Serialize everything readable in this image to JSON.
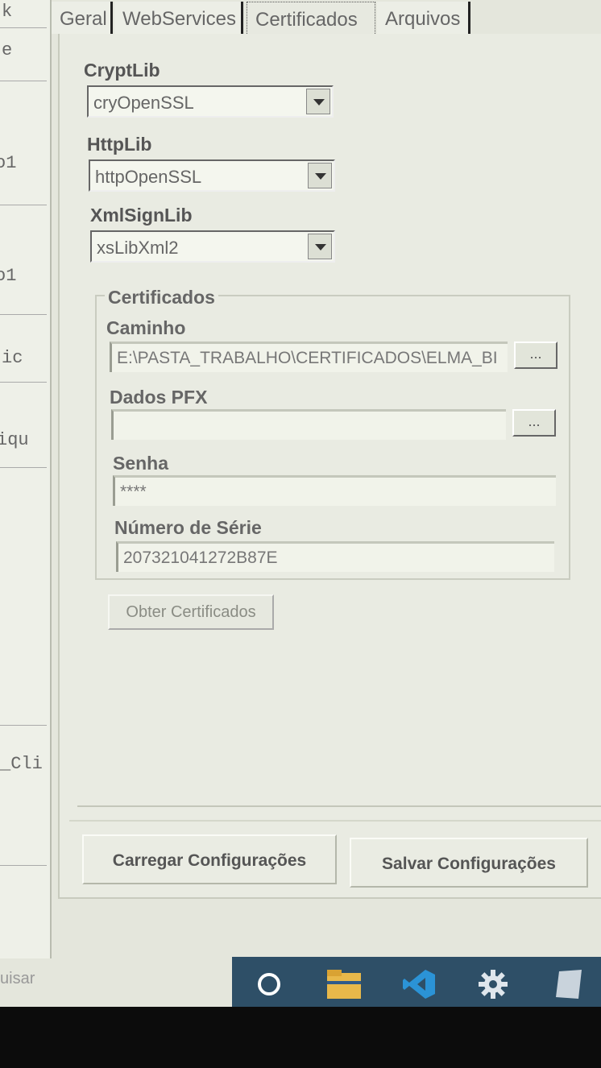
{
  "left_strip": {
    "fragments": [
      "k",
      "e",
      "o1",
      "o1",
      "ic",
      "iqu",
      "_Cli",
      "uisar"
    ]
  },
  "tabs": [
    {
      "label": "Geral"
    },
    {
      "label": "WebServices"
    },
    {
      "label": "Certificados",
      "active": true
    },
    {
      "label": "Arquivos"
    }
  ],
  "crypt": {
    "label": "CryptLib",
    "value": "cryOpenSSL"
  },
  "http": {
    "label": "HttpLib",
    "value": "httpOpenSSL"
  },
  "xml": {
    "label": "XmlSignLib",
    "value": "xsLibXml2"
  },
  "certificados": {
    "title": "Certificados",
    "caminho_label": "Caminho",
    "caminho_value": "E:\\PASTA_TRABALHO\\CERTIFICADOS\\ELMA_BI",
    "pfx_label": "Dados PFX",
    "pfx_value": "",
    "senha_label": "Senha",
    "senha_value": "****",
    "serie_label": "Número de Série",
    "serie_value": "207321041272B87E",
    "browse_label": "..."
  },
  "buttons": {
    "obter": "Obter Certificados",
    "carregar": "Carregar Configurações",
    "salvar": "Salvar Configurações"
  },
  "taskbar": {
    "icons": [
      "cortana-circle-icon",
      "file-explorer-icon",
      "vscode-icon",
      "settings-gear-icon",
      "app-icon"
    ]
  },
  "colors": {
    "taskbar": "#2e4f67",
    "vscode": "#2b93d6"
  }
}
